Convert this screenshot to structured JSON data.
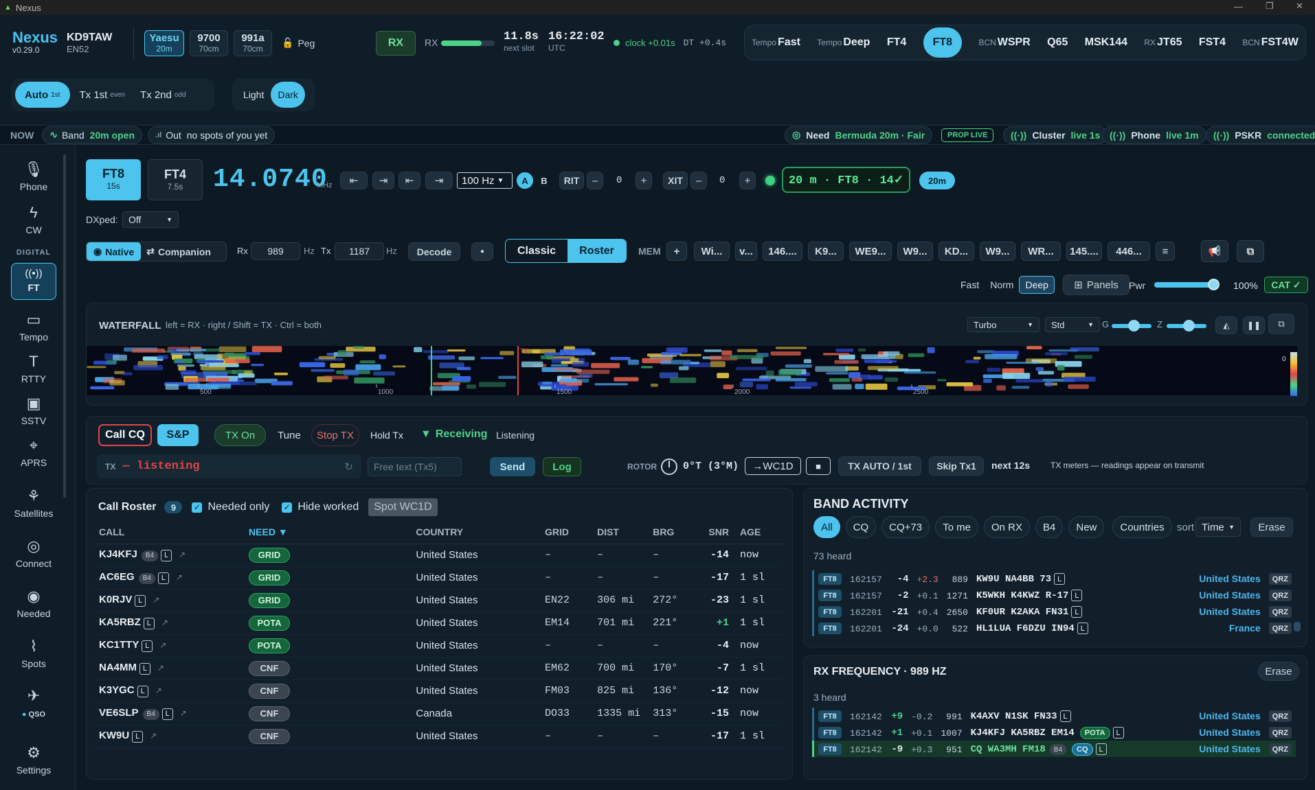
{
  "window": {
    "title": "Nexus"
  },
  "brand": {
    "name": "Nexus",
    "version": "v0.29.0"
  },
  "station": {
    "call": "KD9TAW",
    "grid": "EN52"
  },
  "radios": [
    {
      "name": "Yaesu",
      "band": "20m"
    },
    {
      "name": "9700",
      "band": "70cm"
    },
    {
      "name": "991a",
      "band": "70cm"
    }
  ],
  "peg": "Peg",
  "rx_state": {
    "button": "RX",
    "label": "RX",
    "level": 0.75
  },
  "slot": {
    "secs": "11.8s",
    "label": "next slot"
  },
  "clock": {
    "time": "16:22:02",
    "tz": "UTC",
    "sync": "clock +0.01s",
    "dt": "DT +0.4s"
  },
  "mode_tabs": [
    {
      "prefix": "Tempo",
      "name": "Fast"
    },
    {
      "prefix": "Tempo",
      "name": "Deep"
    },
    {
      "prefix": "",
      "name": "FT4"
    },
    {
      "prefix": "",
      "name": "FT8",
      "active": true
    },
    {
      "prefix": "BCN",
      "name": "WSPR"
    },
    {
      "prefix": "",
      "name": "Q65"
    },
    {
      "prefix": "",
      "name": "MSK144"
    },
    {
      "prefix": "RX",
      "name": "JT65"
    },
    {
      "prefix": "",
      "name": "FST4"
    },
    {
      "prefix": "BCN",
      "name": "FST4W"
    }
  ],
  "tx_seq": {
    "auto": "Auto",
    "auto_sub": "1st",
    "tx1": "Tx 1st",
    "tx1_sub": "even",
    "tx2": "Tx 2nd",
    "tx2_sub": "odd"
  },
  "theme": {
    "light": "Light",
    "dark": "Dark"
  },
  "now_bar": {
    "label": "NOW",
    "band_label": "Band",
    "band_value": "20m open",
    "out_label": "Out",
    "out_value": "no spots of you yet",
    "need_label": "Need",
    "need_value": "Bermuda 20m · Fair",
    "prop": "PROP LIVE",
    "cluster_label": "Cluster",
    "cluster_value": "live 1s",
    "phone_label": "Phone",
    "phone_value": "live 1m",
    "pskr_label": "PSKR",
    "pskr_value": "connected"
  },
  "sidebar": {
    "items": [
      {
        "label": "Phone",
        "icon": "mic-icon"
      },
      {
        "label": "CW",
        "icon": "bolt-icon"
      },
      {
        "label": "FT",
        "icon": "broadcast-icon",
        "active": true
      },
      {
        "label": "Tempo",
        "icon": "chat-icon"
      },
      {
        "label": "RTTY",
        "icon": "text-icon"
      },
      {
        "label": "SSTV",
        "icon": "image-icon"
      },
      {
        "label": "APRS",
        "icon": "pin-icon"
      },
      {
        "label": "Satellites",
        "icon": "satellite-icon"
      },
      {
        "label": "Connect",
        "icon": "connect-icon"
      },
      {
        "label": "Needed",
        "icon": "target-icon"
      },
      {
        "label": "Spots",
        "icon": "wifi-icon"
      },
      {
        "label": "QSO",
        "icon": "plane-icon"
      },
      {
        "label": "Settings",
        "icon": "gear-icon"
      }
    ],
    "section": "DIGITAL"
  },
  "mode_select": [
    {
      "name": "FT8",
      "period": "15s",
      "active": true
    },
    {
      "name": "FT4",
      "period": "7.5s"
    }
  ],
  "freq": {
    "value": "14.0740",
    "unit": "MHz"
  },
  "step": "100 Hz",
  "vfo": {
    "a": "A",
    "b": "B"
  },
  "rit": {
    "label": "RIT",
    "value": "0"
  },
  "xit": {
    "label": "XIT",
    "value": "0"
  },
  "lcd": "20 m · FT8 · 14✓",
  "band_btn": "20m",
  "dxped": {
    "label": "DXped:",
    "value": "Off"
  },
  "decoder": {
    "native": "Native",
    "companion": "Companion",
    "rx_label": "Rx",
    "rx": "989",
    "tx_label": "Tx",
    "tx": "1187",
    "hz": "Hz",
    "decode": "Decode"
  },
  "view": {
    "classic": "Classic",
    "roster": "Roster"
  },
  "mem": {
    "label": "MEM",
    "add": "+",
    "items": [
      "Wi...",
      "v...",
      "146....",
      "K9...",
      "WE9...",
      "W9...",
      "KD...",
      "W9...",
      "WR...",
      "145....",
      "446..."
    ]
  },
  "decode_depth": {
    "fast": "Fast",
    "norm": "Norm",
    "deep": "Deep",
    "panels": "Panels",
    "pwr_label": "Pwr",
    "pwr_value": "100%",
    "pwr_level": 0.95,
    "cat": "CAT ✓"
  },
  "waterfall": {
    "title": "WATERFALL",
    "hint": "left = RX · right / Shift = TX · Ctrl = both",
    "speed": "Turbo",
    "palette": "Std",
    "g": "G",
    "z": "Z",
    "tx_marker": "TX",
    "ticks": [
      "500",
      "1000",
      "1500",
      "2000",
      "2500"
    ],
    "scale_top": "0"
  },
  "tx": {
    "call_cq": "Call CQ",
    "sp": "S&P",
    "tx_on": "TX On",
    "tune": "Tune",
    "stop": "Stop TX",
    "hold": "Hold Tx",
    "receiving": "Receiving",
    "listening": "Listening",
    "msg_label": "TX",
    "msg_value": "— listening",
    "free_placeholder": "Free text (Tx5)",
    "send": "Send",
    "log": "Log",
    "rotor_label": "ROTOR",
    "rotor_value": "0°T (3°M)",
    "rotor_target": "→WC1D",
    "tx_auto": "TX AUTO / 1st",
    "skip": "Skip Tx1",
    "next": "next 12s",
    "meters": "TX meters — readings appear on transmit"
  },
  "roster": {
    "title": "Call Roster",
    "count": "9",
    "needed_only": "Needed only",
    "hide_worked": "Hide worked",
    "spot": "Spot WC1D",
    "columns": [
      "CALL",
      "NEED ▼",
      "COUNTRY",
      "GRID",
      "DIST",
      "BRG",
      "SNR",
      "AGE"
    ],
    "rows": [
      {
        "call": "KJ4KFJ",
        "b4": "B4",
        "need": "GRID",
        "country": "United States",
        "grid": "–",
        "dist": "–",
        "brg": "–",
        "snr": "-14",
        "age": "now"
      },
      {
        "call": "AC6EG",
        "b4": "B4",
        "need": "GRID",
        "country": "United States",
        "grid": "–",
        "dist": "–",
        "brg": "–",
        "snr": "-17",
        "age": "1 sl"
      },
      {
        "call": "K0RJV",
        "b4": "",
        "need": "GRID",
        "country": "United States",
        "grid": "EN22",
        "dist": "306 mi",
        "brg": "272°",
        "snr": "-23",
        "age": "1 sl"
      },
      {
        "call": "KA5RBZ",
        "b4": "",
        "need": "POTA",
        "country": "United States",
        "grid": "EM14",
        "dist": "701 mi",
        "brg": "221°",
        "snr": "+1",
        "age": "1 sl"
      },
      {
        "call": "KC1TTY",
        "b4": "",
        "need": "POTA",
        "country": "United States",
        "grid": "–",
        "dist": "–",
        "brg": "–",
        "snr": "-4",
        "age": "now"
      },
      {
        "call": "NA4MM",
        "b4": "",
        "need": "CNF",
        "country": "United States",
        "grid": "EM62",
        "dist": "700 mi",
        "brg": "170°",
        "snr": "-7",
        "age": "1 sl"
      },
      {
        "call": "K3YGC",
        "b4": "",
        "need": "CNF",
        "country": "United States",
        "grid": "FM03",
        "dist": "825 mi",
        "brg": "136°",
        "snr": "-12",
        "age": "now"
      },
      {
        "call": "VE6SLP",
        "b4": "B4",
        "need": "CNF",
        "country": "Canada",
        "grid": "DO33",
        "dist": "1335 mi",
        "brg": "313°",
        "snr": "-15",
        "age": "now"
      },
      {
        "call": "KW9U",
        "b4": "",
        "need": "CNF",
        "country": "United States",
        "grid": "–",
        "dist": "–",
        "brg": "–",
        "snr": "-17",
        "age": "1 sl"
      }
    ]
  },
  "activity": {
    "title": "BAND ACTIVITY",
    "filters": [
      "All",
      "CQ",
      "CQ+73",
      "To me",
      "On RX",
      "B4",
      "New",
      "Countries"
    ],
    "sort_label": "sort",
    "sort_value": "Time",
    "erase": "Erase",
    "heard": "73 heard",
    "rows": [
      {
        "mode": "FT8",
        "time": "162157",
        "snr": "-4",
        "dt": "+2.3",
        "freq": "889",
        "msg": "KW9U NA4BB 73",
        "country": "United States",
        "qrz": "QRZ"
      },
      {
        "mode": "FT8",
        "time": "162157",
        "snr": "-2",
        "dt": "+0.1",
        "freq": "1271",
        "msg": "K5WKH K4KWZ R-17",
        "country": "United States",
        "qrz": "QRZ"
      },
      {
        "mode": "FT8",
        "time": "162201",
        "snr": "-21",
        "dt": "+0.4",
        "freq": "2650",
        "msg": "KF0UR K2AKA FN31",
        "country": "United States",
        "qrz": "QRZ"
      },
      {
        "mode": "FT8",
        "time": "162201",
        "snr": "-24",
        "dt": "+0.0",
        "freq": "522",
        "msg": "HL1LUA F6DZU IN94",
        "country": "France",
        "qrz": "QRZ"
      }
    ]
  },
  "rxfreq": {
    "title": "RX FREQUENCY · 989 HZ",
    "erase": "Erase",
    "heard": "3 heard",
    "rows": [
      {
        "mode": "FT8",
        "time": "162142",
        "snr": "+9",
        "dt": "-0.2",
        "freq": "991",
        "msg": "K4AXV N1SK FN33",
        "country": "United States",
        "qrz": "QRZ"
      },
      {
        "mode": "FT8",
        "time": "162142",
        "snr": "+1",
        "dt": "+0.1",
        "freq": "1007",
        "msg": "KJ4KFJ KA5RBZ EM14",
        "badge": "POTA",
        "country": "United States",
        "qrz": "QRZ"
      },
      {
        "mode": "FT8",
        "time": "162142",
        "snr": "-9",
        "dt": "+0.3",
        "freq": "951",
        "msg": "CQ WA3MH FM18",
        "badge": "CQ",
        "b4": "B4",
        "country": "United States",
        "qrz": "QRZ"
      }
    ]
  },
  "colors": {
    "accent": "#4cc4ee",
    "bg": "#0d1a24",
    "green": "#4fd18a",
    "red": "#e0454a"
  }
}
